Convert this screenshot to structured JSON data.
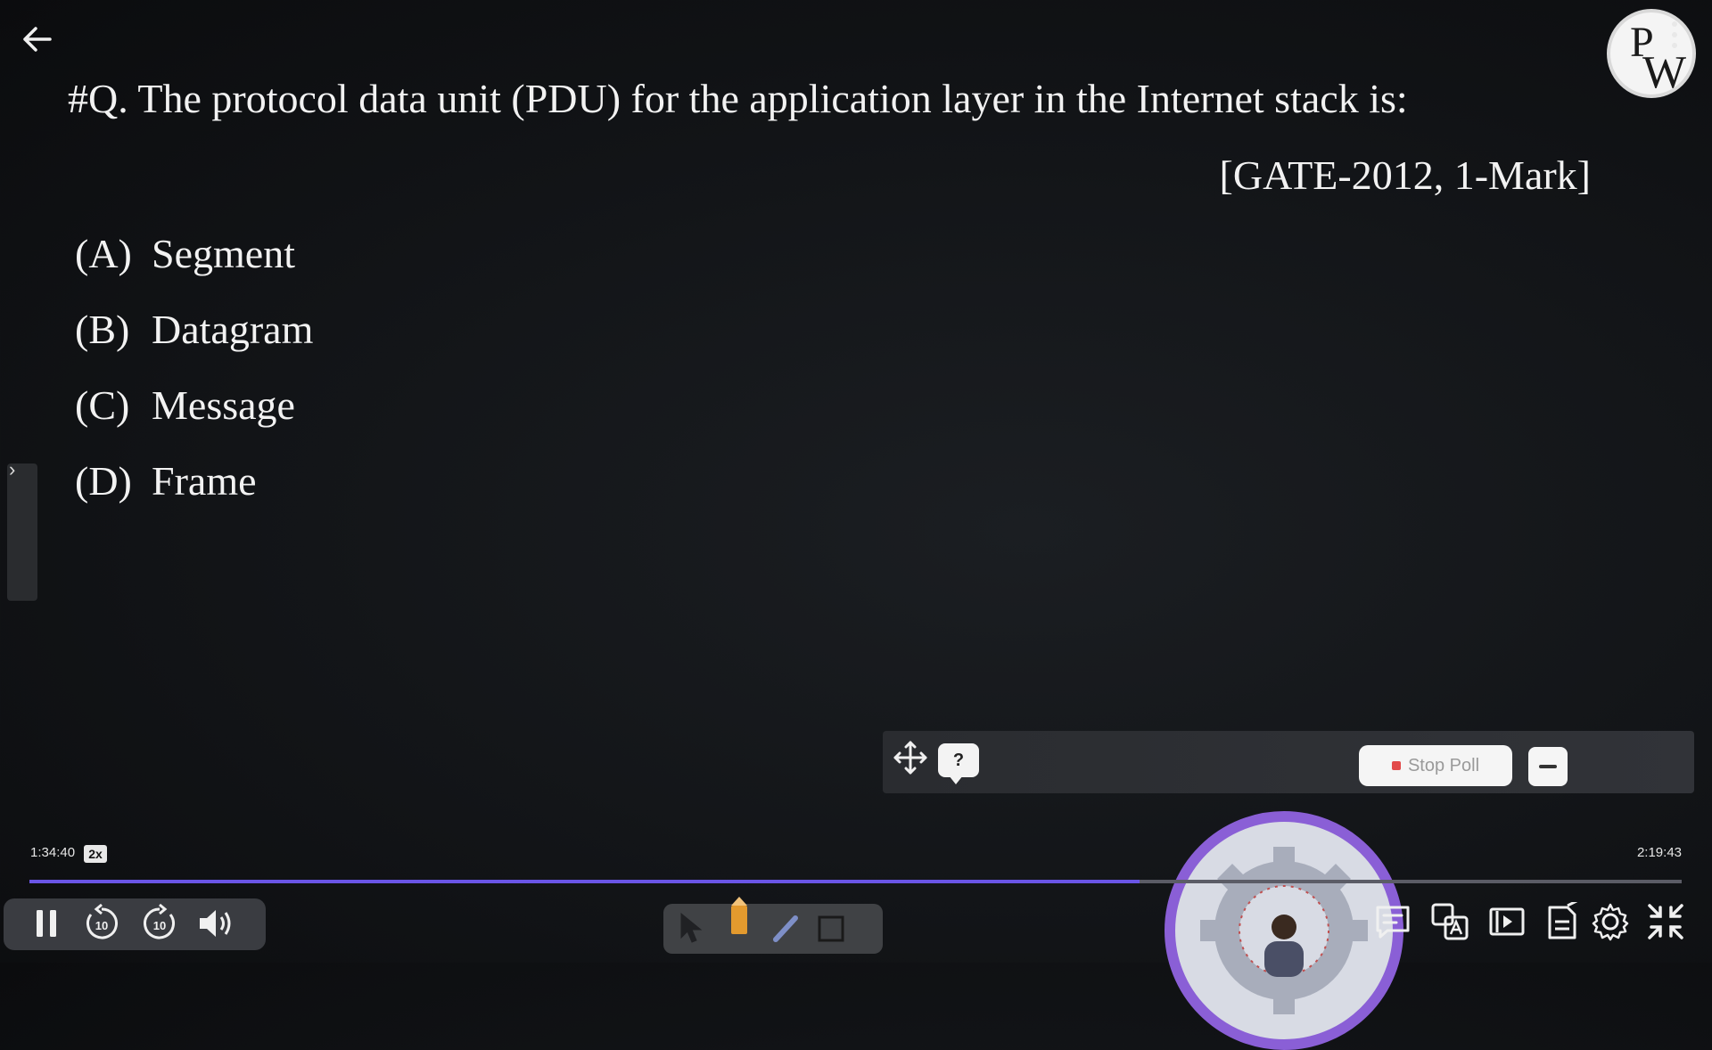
{
  "question": {
    "text": "#Q. The protocol data unit (PDU) for the application layer in the Internet stack is:",
    "source": "[GATE-2012, 1-Mark]",
    "options": [
      {
        "letter": "(A)",
        "text": "Segment"
      },
      {
        "letter": "(B)",
        "text": "Datagram"
      },
      {
        "letter": "(C)",
        "text": "Message"
      },
      {
        "letter": "(D)",
        "text": "Frame"
      }
    ]
  },
  "logo": {
    "letters_top": "P",
    "letters_bottom": "W"
  },
  "poll": {
    "stop_label": "Stop Poll",
    "help_symbol": "?"
  },
  "player": {
    "current_time": "1:34:40",
    "total_time": "2:19:43",
    "speed": "2x",
    "skip_seconds": "10",
    "progress_fraction": 0.672
  },
  "colors": {
    "accent": "#6a55e6",
    "badge_ring": "#8a5fd6",
    "stop_dot": "#e24a4a"
  },
  "icons": [
    "back-arrow-icon",
    "more-vertical-icon",
    "move-icon",
    "question-bubble-icon",
    "pause-icon",
    "rewind-10-icon",
    "forward-10-icon",
    "volume-icon",
    "pointer-icon",
    "pencil-icon",
    "highlighter-icon",
    "rectangle-icon",
    "chat-icon",
    "translate-icon",
    "picture-in-picture-icon",
    "notes-icon",
    "settings-gear-icon",
    "exit-fullscreen-icon"
  ]
}
